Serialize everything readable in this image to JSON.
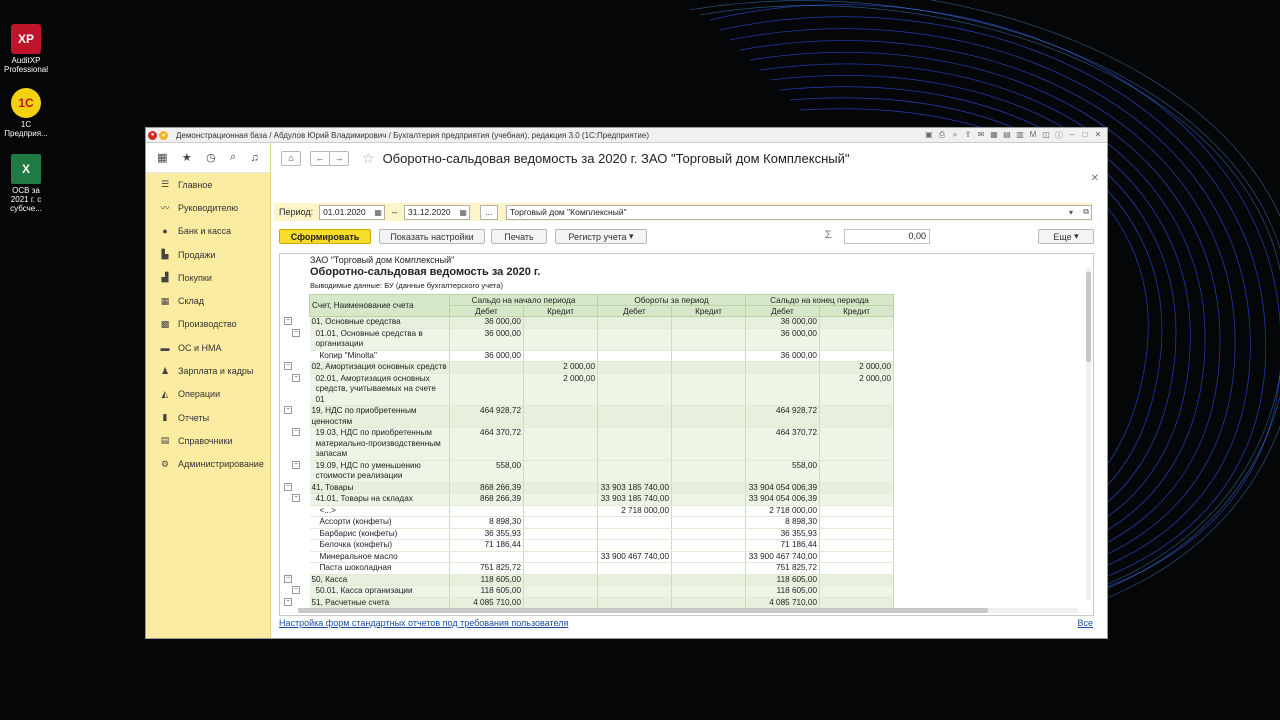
{
  "desktop": {
    "icons": [
      {
        "label": "AuditXP Professional",
        "glyph": "XP"
      },
      {
        "label": "1С Предприя...",
        "glyph": "1С"
      },
      {
        "label": "ОСВ за 2021 г. с субсче...",
        "glyph": "X"
      }
    ]
  },
  "window": {
    "title": "Демонстрационная база / Абдулов Юрий Владимирович / Бухгалтерия предприятия (учебная), редакция 3.0  (1С:Предприятие)"
  },
  "sidebar": {
    "items": [
      {
        "label": "Главное",
        "icon": "menu-icon"
      },
      {
        "label": "Руководителю",
        "icon": "trend-icon"
      },
      {
        "label": "Банк и касса",
        "icon": "bank-icon"
      },
      {
        "label": "Продажи",
        "icon": "cart-icon"
      },
      {
        "label": "Покупки",
        "icon": "basket-icon"
      },
      {
        "label": "Склад",
        "icon": "warehouse-icon"
      },
      {
        "label": "Производство",
        "icon": "factory-icon"
      },
      {
        "label": "ОС и НМА",
        "icon": "truck-icon"
      },
      {
        "label": "Зарплата и кадры",
        "icon": "person-icon"
      },
      {
        "label": "Операции",
        "icon": "operations-icon"
      },
      {
        "label": "Отчеты",
        "icon": "chart-icon"
      },
      {
        "label": "Справочники",
        "icon": "book-icon"
      },
      {
        "label": "Администрирование",
        "icon": "gear-icon"
      }
    ]
  },
  "main": {
    "title": "Оборотно-сальдовая ведомость за 2020 г. ЗАО \"Торговый дом Комплексный\"",
    "period_label": "Период:",
    "date_from": "01.01.2020",
    "date_sep": "–",
    "date_to": "31.12.2020",
    "ellipsis": "...",
    "organization": "Торговый дом \"Комплексный\"",
    "buttons": {
      "generate": "Сформировать",
      "settings": "Показать настройки",
      "print": "Печать",
      "register": "Регистр учета",
      "more": "Еще"
    },
    "sum_value": "0,00",
    "footer_link": "Настройка форм стандартных отчетов под требования пользователя",
    "footer_all": "Все"
  },
  "report": {
    "org": "ЗАО \"Торговый дом Комплексный\"",
    "title": "Оборотно-сальдовая ведомость за 2020 г.",
    "output": "Выводимые данные:  БУ (данные бухгалтерского учета)",
    "headers": {
      "account": "Счет, Наименование счета",
      "start": "Сальдо на начало периода",
      "turnover": "Обороты за период",
      "end": "Сальдо на конец периода",
      "debit": "Дебет",
      "credit": "Кредит"
    },
    "rows": [
      {
        "type": "grp",
        "name": "01, Основные средства",
        "v": [
          "36 000,00",
          "",
          "",
          "",
          "36 000,00",
          ""
        ]
      },
      {
        "type": "sub",
        "name": "01.01, Основные средства в организации",
        "v": [
          "36 000,00",
          "",
          "",
          "",
          "36 000,00",
          ""
        ]
      },
      {
        "type": "leaf",
        "name": "Копир \"Minolta\"",
        "v": [
          "36 000,00",
          "",
          "",
          "",
          "36 000,00",
          ""
        ]
      },
      {
        "type": "grp",
        "name": "02, Амортизация основных средств",
        "v": [
          "",
          "2 000,00",
          "",
          "",
          "",
          "2 000,00"
        ]
      },
      {
        "type": "sub",
        "name": "02.01, Амортизация основных средств, учитываемых на счете 01",
        "v": [
          "",
          "2 000,00",
          "",
          "",
          "",
          "2 000,00"
        ]
      },
      {
        "type": "grp",
        "name": "19, НДС по приобретенным ценностям",
        "v": [
          "464 928,72",
          "",
          "",
          "",
          "464 928,72",
          ""
        ]
      },
      {
        "type": "sub",
        "name": "19.03, НДС по приобретенным материально-производственным запасам",
        "v": [
          "464 370,72",
          "",
          "",
          "",
          "464 370,72",
          ""
        ]
      },
      {
        "type": "sub",
        "name": "19.09, НДС по уменьшению стоимости реализации",
        "v": [
          "558,00",
          "",
          "",
          "",
          "558,00",
          ""
        ]
      },
      {
        "type": "grp",
        "name": "41, Товары",
        "v": [
          "868 266,39",
          "",
          "33 903 185 740,00",
          "",
          "33 904 054 006,39",
          ""
        ]
      },
      {
        "type": "sub",
        "name": "41.01, Товары на складах",
        "v": [
          "868 266,39",
          "",
          "33 903 185 740,00",
          "",
          "33 904 054 006,39",
          ""
        ]
      },
      {
        "type": "leaf",
        "name": "<...>",
        "v": [
          "",
          "",
          "2 718 000,00",
          "",
          "2 718 000,00",
          ""
        ]
      },
      {
        "type": "leaf",
        "name": "Ассорти (конфеты)",
        "v": [
          "8 898,30",
          "",
          "",
          "",
          "8 898,30",
          ""
        ]
      },
      {
        "type": "leaf",
        "name": "Барбарис (конфеты)",
        "v": [
          "36 355,93",
          "",
          "",
          "",
          "36 355,93",
          ""
        ]
      },
      {
        "type": "leaf",
        "name": "Белочка (конфеты)",
        "v": [
          "71 186,44",
          "",
          "",
          "",
          "71 186,44",
          ""
        ]
      },
      {
        "type": "leaf",
        "name": "Минеральное масло",
        "v": [
          "",
          "",
          "33 900 467 740,00",
          "",
          "33 900 467 740,00",
          ""
        ]
      },
      {
        "type": "leaf",
        "name": "Паста шоколадная",
        "v": [
          "751 825,72",
          "",
          "",
          "",
          "751 825,72",
          ""
        ]
      },
      {
        "type": "grp",
        "name": "50, Касса",
        "v": [
          "118 605,00",
          "",
          "",
          "",
          "118 605,00",
          ""
        ]
      },
      {
        "type": "sub",
        "name": "50.01, Касса организации",
        "v": [
          "118 605,00",
          "",
          "",
          "",
          "118 605,00",
          ""
        ]
      },
      {
        "type": "grp",
        "name": "51, Расчетные счета",
        "v": [
          "4 085 710,00",
          "",
          "",
          "",
          "4 085 710,00",
          ""
        ]
      }
    ]
  }
}
